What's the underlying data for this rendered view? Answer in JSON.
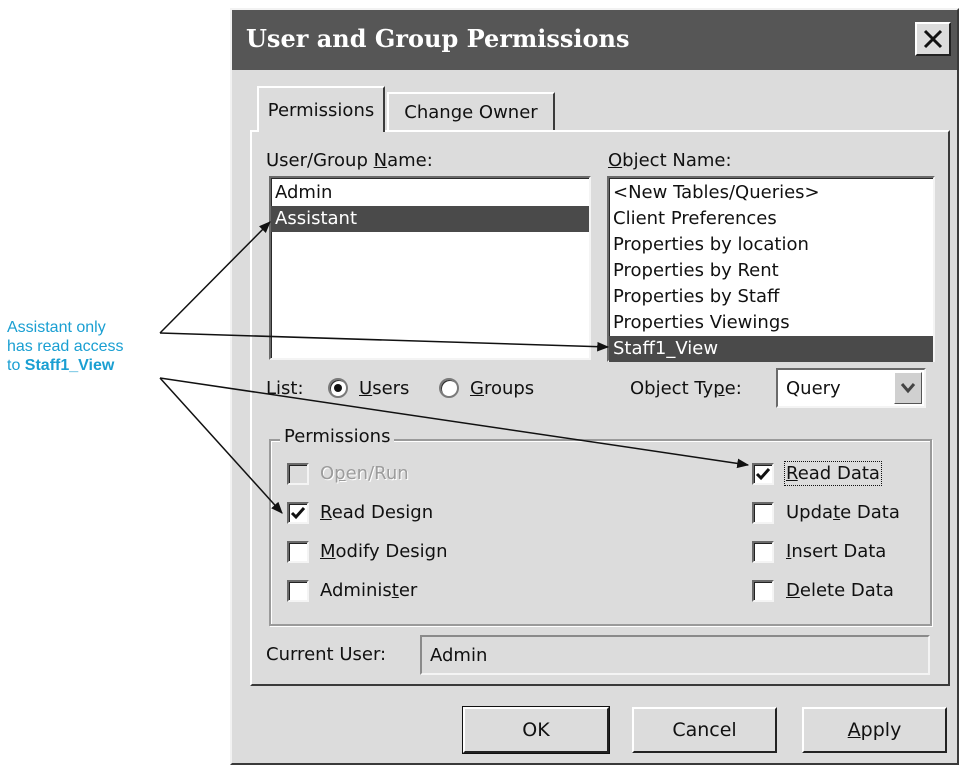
{
  "dialog": {
    "title": "User and Group Permissions",
    "tabs": [
      {
        "label": "Permissions",
        "active": true
      },
      {
        "label": "Change Owner",
        "active": false
      }
    ]
  },
  "users": {
    "label_pre": "User/Group ",
    "label_ul": "N",
    "label_post": "ame:",
    "items": [
      {
        "label": "Admin",
        "selected": false
      },
      {
        "label": "Assistant",
        "selected": true
      }
    ]
  },
  "objects": {
    "label_ul": "O",
    "label_post": "bject Name:",
    "items": [
      {
        "label": "<New Tables/Queries>",
        "selected": false
      },
      {
        "label": "Client Preferences",
        "selected": false
      },
      {
        "label": "Properties by location",
        "selected": false
      },
      {
        "label": "Properties by Rent",
        "selected": false
      },
      {
        "label": "Properties by Staff",
        "selected": false
      },
      {
        "label": "Properties Viewings",
        "selected": false
      },
      {
        "label": "Staff1_View",
        "selected": true
      }
    ]
  },
  "list": {
    "label": "List:",
    "users_ul": "U",
    "users_rest": "sers",
    "groups_ul": "G",
    "groups_rest": "roups",
    "selected": "Users"
  },
  "object_type": {
    "label_pre": "Object Ty",
    "label_ul": "p",
    "label_post": "e:",
    "value": "Query"
  },
  "permissions": {
    "group_title": "Permissions",
    "open_run": {
      "pre": "O",
      "ul": "p",
      "post": "en/Run",
      "checked": false,
      "enabled": false
    },
    "read_design": {
      "pre": "",
      "ul": "R",
      "post": "ead Design",
      "checked": true
    },
    "modify_design": {
      "pre": "",
      "ul": "M",
      "post": "odify Design",
      "checked": false
    },
    "administer": {
      "pre": "Adminis",
      "ul": "t",
      "post": "er",
      "checked": false
    },
    "read_data": {
      "pre": "",
      "ul": "R",
      "post": "ead Data",
      "checked": true
    },
    "update_data": {
      "pre": "Upda",
      "ul": "t",
      "post": "e Data",
      "checked": false
    },
    "insert_data": {
      "pre": "",
      "ul": "I",
      "post": "nsert Data",
      "checked": false
    },
    "delete_data": {
      "pre": "",
      "ul": "D",
      "post": "elete Data",
      "checked": false
    }
  },
  "current_user": {
    "label": "Current User:",
    "value": "Admin"
  },
  "buttons": {
    "ok": "OK",
    "cancel": "Cancel",
    "apply_ul": "A",
    "apply_rest": "pply"
  },
  "annotation": {
    "line1": "Assistant only",
    "line2": "has read access",
    "line3_pre": "to ",
    "line3_bold": "Staff1_View"
  },
  "colors": {
    "annotation": "#1a9fd2",
    "titlebar": "#565656",
    "selection": "#4a4a4a"
  }
}
